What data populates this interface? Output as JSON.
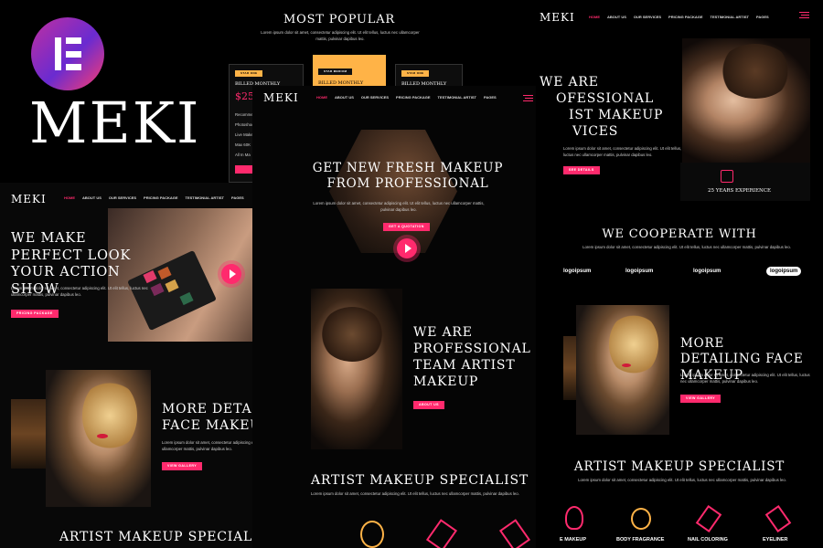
{
  "brand": {
    "name": "MEKI",
    "badge_icon": "elementor-logo-icon",
    "accent": "#ff2a6d",
    "dark": "#0a0a0a"
  },
  "nav": {
    "logo": "MEKI",
    "items": [
      "HOME",
      "ABOUT US",
      "OUR SERVICES",
      "PRICING PACKAGE",
      "TESTIMONIAL ARTIST",
      "PAGES"
    ]
  },
  "pricing": {
    "title": "MOST POPULAR",
    "text": "Lorem ipsum dolor sit amet, consectetur adipiscing elit. Ut elit tellus, luctus nec ullamcorper mattis, pulvinar dapibus leo.",
    "plans": [
      {
        "badge": "STAR ONE",
        "billing": "BILLED MONTHLY",
        "price": "$25"
      },
      {
        "badge": "STAR MEDIUM",
        "billing": "BILLED MONTHLY"
      },
      {
        "badge": "STAR ONE",
        "billing": "BILLED MONTHLY"
      }
    ],
    "features": [
      "Recommend",
      "Photoshoo",
      "Live Make",
      "Max 60K",
      "All In Ma"
    ]
  },
  "hero_left": {
    "title": "WE MAKE PERFECT LOOK YOUR ACTION SHOW",
    "text": "Lorem ipsum dolor sit amet, consectetur adipiscing elit. Ut elit tellus, luctus nec ullamcorper mattis, pulvinar dapibus leo.",
    "button": "PRICING PACKAGE"
  },
  "detail_left": {
    "title": "MORE DETAILING FACE MAKEUP",
    "text": "Lorem ipsum dolor sit amet, consectetur adipiscing elit. Ut elit tellus, luctus nec ullamcorper mattis, pulvinar dapibus leo.",
    "button": "VIEW GALLERY"
  },
  "specialist_left": {
    "title": "ARTIST MAKEUP SPECIALIST"
  },
  "center": {
    "title": "GET NEW FRESH MAKEUP FROM PROFESSIONAL",
    "text": "Lorem ipsum dolor sit amet, consectetur adipiscing elit. Ut elit tellus, luctus nec ullamcorper mattis, pulvinar dapibus leo.",
    "button": "GET A QUOTATION",
    "about_title": "WE ARE PROFESSIONAL TEAM ARTIST MAKEUP",
    "about_button": "ABOUT US",
    "specialist_title": "ARTIST MAKEUP SPECIALIST",
    "specialist_text": "Lorem ipsum dolor sit amet, consectetur adipiscing elit. Ut elit tellus, luctus nec ullamcorper mattis, pulvinar dapibus leo."
  },
  "right": {
    "title_lines": [
      "WE ARE",
      "OFESSIONAL",
      "IST MAKEUP",
      "VICES"
    ],
    "text": "Lorem ipsum dolor sit amet, consectetur adipiscing elit. Ut elit tellus, luctus nec ullamcorper mattis, pulvinar dapibus leo.",
    "button": "SEE DETAILS",
    "experience": "25 YEARS EXPERIENCE",
    "cooperate_title": "WE COOPERATE WITH",
    "cooperate_text": "Lorem ipsum dolor sit amet, consectetur adipiscing elit. Ut elit tellus, luctus nec ullamcorper mattis, pulvinar dapibus leo.",
    "partners": [
      "logoipsum",
      "logoipsum",
      "logoipsum",
      "logoipsum"
    ],
    "detail_title": "MORE DETAILING FACE MAKEUP",
    "detail_text": "Lorem ipsum dolor sit amet, consectetur adipiscing elit. Ut elit tellus, luctus nec ullamcorper mattis, pulvinar dapibus leo.",
    "detail_button": "VIEW GALLERY",
    "specialist_title": "ARTIST MAKEUP SPECIALIST",
    "specialist_text": "Lorem ipsum dolor sit amet, consectetur adipiscing elit. Ut elit tellus, luctus nec ullamcorper mattis, pulvinar dapibus leo.",
    "services": [
      "E MAKEUP",
      "BODY FRAGRANCE",
      "NAIL COLORING",
      "EYELINER"
    ]
  }
}
